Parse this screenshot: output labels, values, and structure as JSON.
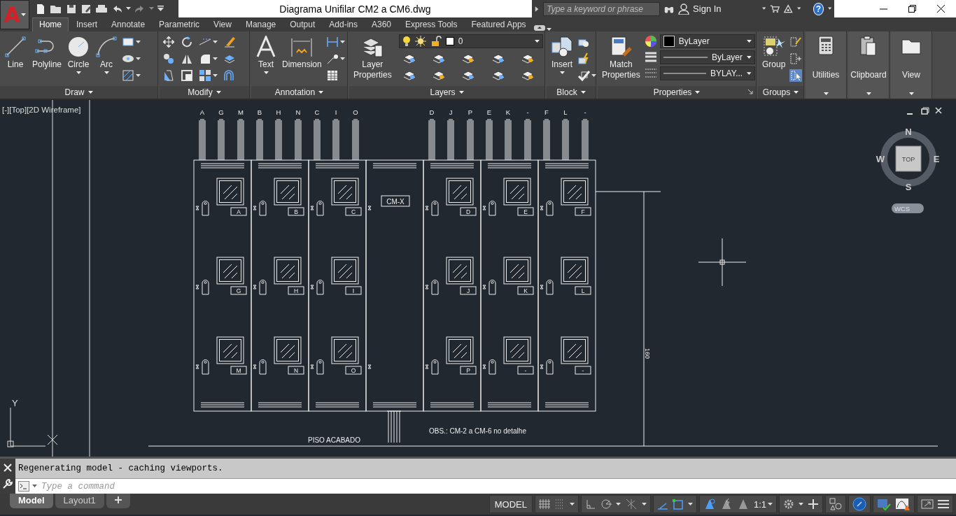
{
  "app_button": {
    "letter": "A"
  },
  "window": {
    "title": "Diagrama Unifilar CM2 a CM6.dwg"
  },
  "search": {
    "placeholder": "Type a keyword or phrase"
  },
  "account": {
    "label": "Sign In"
  },
  "help": {
    "label": "?"
  },
  "tabs": [
    {
      "label": "Home",
      "selected": true
    },
    {
      "label": "Insert",
      "selected": false
    },
    {
      "label": "Annotate",
      "selected": false
    },
    {
      "label": "Parametric",
      "selected": false
    },
    {
      "label": "View",
      "selected": false
    },
    {
      "label": "Manage",
      "selected": false
    },
    {
      "label": "Output",
      "selected": false
    },
    {
      "label": "Add-ins",
      "selected": false
    },
    {
      "label": "A360",
      "selected": false
    },
    {
      "label": "Express Tools",
      "selected": false
    },
    {
      "label": "Featured Apps",
      "selected": false
    }
  ],
  "ribbon": {
    "panels": [
      {
        "kind": "draw",
        "title": "Draw",
        "large": [
          {
            "label": "Line",
            "dropdown": false
          },
          {
            "label": "Polyline",
            "dropdown": false
          },
          {
            "label": "Circle",
            "dropdown": true
          },
          {
            "label": "Arc",
            "dropdown": true
          }
        ]
      },
      {
        "kind": "modify",
        "title": "Modify"
      },
      {
        "kind": "annotation",
        "title": "Annotation",
        "large": [
          {
            "label": "Text",
            "dropdown": true
          },
          {
            "label": "Dimension",
            "dropdown": false
          }
        ]
      },
      {
        "kind": "layers",
        "title": "Layers",
        "large": [
          {
            "label": "Layer Properties",
            "dropdown": false
          }
        ],
        "layer": "0"
      },
      {
        "kind": "block",
        "title": "Block",
        "large": [
          {
            "label": "Insert",
            "dropdown": true
          }
        ]
      },
      {
        "kind": "properties",
        "title": "Properties",
        "large": [
          {
            "label": "Match Properties",
            "dropdown": false
          }
        ],
        "combos": [
          {
            "kind": "color",
            "value": "ByLayer"
          },
          {
            "kind": "line",
            "value": "ByLayer"
          },
          {
            "kind": "line",
            "value": "BYLAY..."
          }
        ]
      },
      {
        "kind": "groups",
        "title": "Groups",
        "large": [
          {
            "label": "Group",
            "dropdown": false
          }
        ]
      },
      {
        "kind": "collapsed",
        "title": "Utilities"
      },
      {
        "kind": "collapsed",
        "title": "Clipboard"
      },
      {
        "kind": "collapsed",
        "title": "View"
      }
    ]
  },
  "viewport": {
    "label": "[-][Top][2D Wireframe]",
    "viewcube": {
      "north": "N",
      "south": "S",
      "east": "E",
      "west": "W",
      "face": "TOP",
      "ucs": "WCS"
    },
    "axis_label": "Y"
  },
  "drawing": {
    "cabinets": [
      {
        "kind": "panel",
        "feeders": [
          "A",
          "G",
          "M"
        ],
        "tags": [
          "A",
          "G",
          "M"
        ]
      },
      {
        "kind": "panel",
        "feeders": [
          "B",
          "H",
          "N"
        ],
        "tags": [
          "B",
          "H",
          "N"
        ]
      },
      {
        "kind": "panel",
        "feeders": [
          "C",
          "I",
          "O"
        ],
        "tags": [
          "C",
          "I",
          "O"
        ]
      },
      {
        "kind": "spare",
        "label": "CM-X"
      },
      {
        "kind": "panel",
        "feeders": [
          "D",
          "J",
          "P"
        ],
        "tags": [
          "D",
          "J",
          "P"
        ]
      },
      {
        "kind": "panel",
        "feeders": [
          "E",
          "K",
          "-"
        ],
        "tags": [
          "E",
          "K",
          "-"
        ]
      },
      {
        "kind": "panel",
        "feeders": [
          "F",
          "L",
          "-"
        ],
        "tags": [
          "F",
          "L",
          "-"
        ]
      }
    ],
    "floor_label": "PISO ACABADO",
    "note": "OBS.: CM-2 a CM-6 no detalhe",
    "dimension": "160"
  },
  "command": {
    "history": "Regenerating model - caching viewports.",
    "placeholder": "Type a command"
  },
  "layout_tabs": [
    {
      "label": "Model",
      "selected": true
    },
    {
      "label": "Layout1",
      "selected": false
    }
  ],
  "status_bar": {
    "space": "MODEL",
    "scale": "1:1"
  }
}
